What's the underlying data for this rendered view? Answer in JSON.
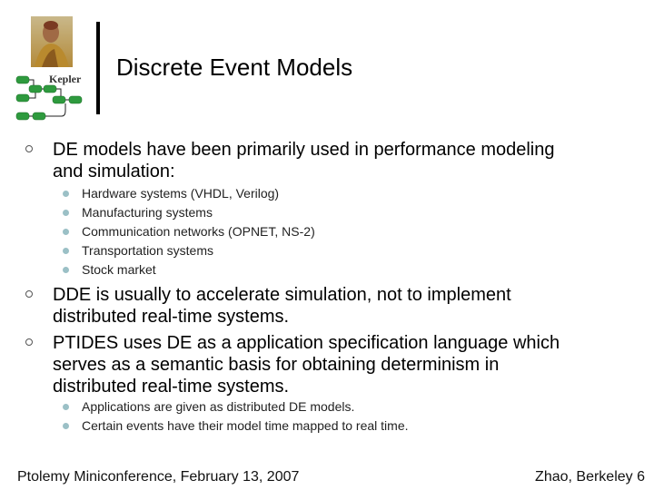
{
  "slide": {
    "logo_text": "Kepler",
    "title": "Discrete Event Models",
    "bullets": [
      {
        "text_lines": [
          "DE models have been primarily used in performance modeling",
          "and simulation:"
        ],
        "sub": [
          "Hardware systems (VHDL, Verilog)",
          "Manufacturing systems",
          "Communication networks (OPNET, NS-2)",
          "Transportation systems",
          "Stock market"
        ]
      },
      {
        "text_lines": [
          "DDE is usually to accelerate simulation, not to implement",
          "distributed real-time systems."
        ],
        "sub": []
      },
      {
        "text_lines": [
          "PTIDES uses DE as a application specification language which",
          "serves as a semantic basis for obtaining determinism in",
          "distributed real-time systems."
        ],
        "sub": [
          "Applications are given as distributed DE models.",
          "Certain events have their model time mapped to real time."
        ]
      }
    ],
    "footer_left": "Ptolemy Miniconference, February 13, 2007",
    "footer_right": "Zhao, Berkeley 6"
  },
  "colors": {
    "sub_bullet": "#9bc0c6",
    "logo_green": "#2e9a3e"
  }
}
